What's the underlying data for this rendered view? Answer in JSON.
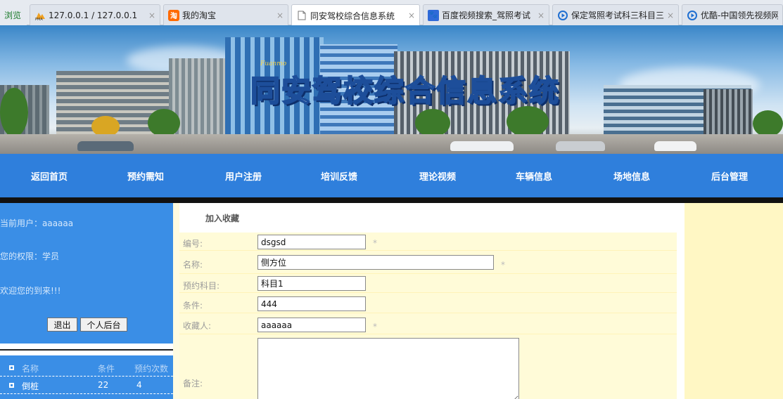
{
  "browser": {
    "tabs": [
      {
        "title": "浏览",
        "icon": "compat-view-icon",
        "active": false
      },
      {
        "title": "127.0.0.1 / 127.0.0.1",
        "icon": "phpmyadmin-icon",
        "active": false
      },
      {
        "title": "我的淘宝",
        "icon": "taobao-icon",
        "active": false
      },
      {
        "title": "同安驾校综合信息系统",
        "icon": "page-icon",
        "active": true
      },
      {
        "title": "百度视频搜索_驾照考试",
        "icon": "baidu-icon",
        "active": false
      },
      {
        "title": "保定驾照考试科三科目三",
        "icon": "play-icon",
        "active": false
      },
      {
        "title": "优酷-中国领先视频网",
        "icon": "play-icon",
        "active": false
      }
    ],
    "close_glyph": "×"
  },
  "banner": {
    "title": "同安驾校综合信息系统",
    "logo_text": "Fuanmo"
  },
  "nav": {
    "items": [
      "返回首页",
      "预约需知",
      "用户注册",
      "培训反馈",
      "理论视频",
      "车辆信息",
      "场地信息",
      "后台管理"
    ]
  },
  "sidebar": {
    "current_user": "当前用户：aaaaaa",
    "role": "您的权限：学员",
    "welcome": "欢迎您的到来!!!",
    "logout_label": "退出",
    "personal_label": "个人后台"
  },
  "side_list": {
    "headers": [
      "名称",
      "条件",
      "预约次数"
    ],
    "rows": [
      [
        "倒桩",
        "22",
        "4"
      ]
    ]
  },
  "main": {
    "heading": "加入收藏",
    "required_mark": "*",
    "fields": [
      {
        "label": "编号:",
        "value": "dsgsd",
        "required": true
      },
      {
        "label": "名称:",
        "value": "侧方位",
        "required": true
      },
      {
        "label": "预约科目:",
        "value": "科目1",
        "required": false
      },
      {
        "label": "条件:",
        "value": "444",
        "required": false
      },
      {
        "label": "收藏人:",
        "value": "aaaaaa",
        "required": true
      },
      {
        "label": "备注:",
        "value": "",
        "required": false
      }
    ]
  }
}
